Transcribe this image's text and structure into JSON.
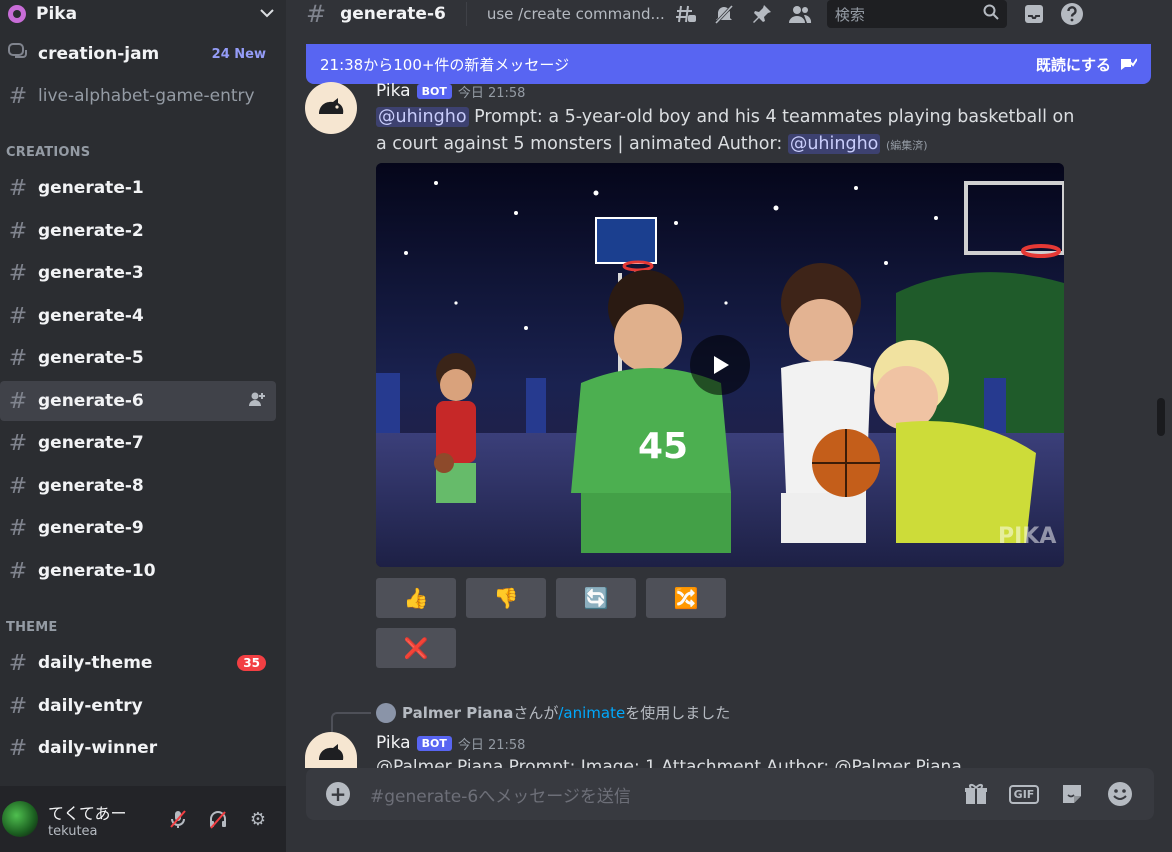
{
  "server": {
    "name": "Pika"
  },
  "sidebar": {
    "top_channels": [
      {
        "label": "creation-jam",
        "extra": "24 New"
      },
      {
        "label": "live-alphabet-game-entry"
      }
    ],
    "categories": {
      "creations": "CREATIONS",
      "theme": "THEME"
    },
    "creations": [
      "generate-1",
      "generate-2",
      "generate-3",
      "generate-4",
      "generate-5",
      "generate-6",
      "generate-7",
      "generate-8",
      "generate-9",
      "generate-10"
    ],
    "theme": [
      {
        "label": "daily-theme",
        "badge": "35"
      },
      {
        "label": "daily-entry"
      },
      {
        "label": "daily-winner"
      }
    ]
  },
  "user": {
    "display_name": "てくてあー",
    "handle": "tekutea"
  },
  "header": {
    "channel": "generate-6",
    "topic": "use /create command...",
    "search_placeholder": "検索"
  },
  "banner": {
    "text": "21:38から100+件の新着メッセージ",
    "action": "既読にする"
  },
  "message1": {
    "author": "Pika",
    "bot_tag": "BOT",
    "time": "今日 21:58",
    "mention": "@uhingho",
    "prompt": "Prompt: a 5-year-old boy and his 4 teammates playing basketball on a court against 5 monsters | animated  Author:",
    "author_mention": "@uhingho",
    "edited": "(編集済)",
    "buttons": [
      "👍",
      "👎",
      "🔄",
      "🔀",
      "❌"
    ]
  },
  "reply": {
    "user": "Palmer Piana",
    "suffix1": "さんが",
    "command": "/animate",
    "suffix2": "を使用しました"
  },
  "message2": {
    "author": "Pika",
    "bot_tag": "BOT",
    "time": "今日 21:58",
    "partial": "@Palmer Piana Prompt: Image: 1 Attachment  Author: @Palmer Piana"
  },
  "composer": {
    "placeholder": "#generate-6へメッセージを送信"
  },
  "colors": {
    "accent": "#5865f2",
    "background": "#313338",
    "sidebar": "#2b2d31",
    "mention_badge": "#f23f43"
  }
}
